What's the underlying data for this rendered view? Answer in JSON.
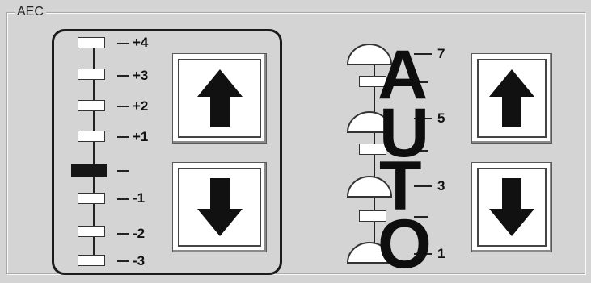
{
  "group": {
    "title": "AEC"
  },
  "exposure_scale": {
    "levels": [
      "+4",
      "+3",
      "+2",
      "+1",
      "",
      "-1",
      "-2",
      "-3"
    ],
    "current_index": 4
  },
  "auto_scale": {
    "letters": [
      "A",
      "U",
      "T",
      "O"
    ],
    "labels": [
      "7",
      "5",
      "3",
      "1"
    ]
  },
  "buttons": {
    "left_up_icon": "arrow-up",
    "left_down_icon": "arrow-down",
    "right_up_icon": "arrow-up",
    "right_down_icon": "arrow-down"
  }
}
